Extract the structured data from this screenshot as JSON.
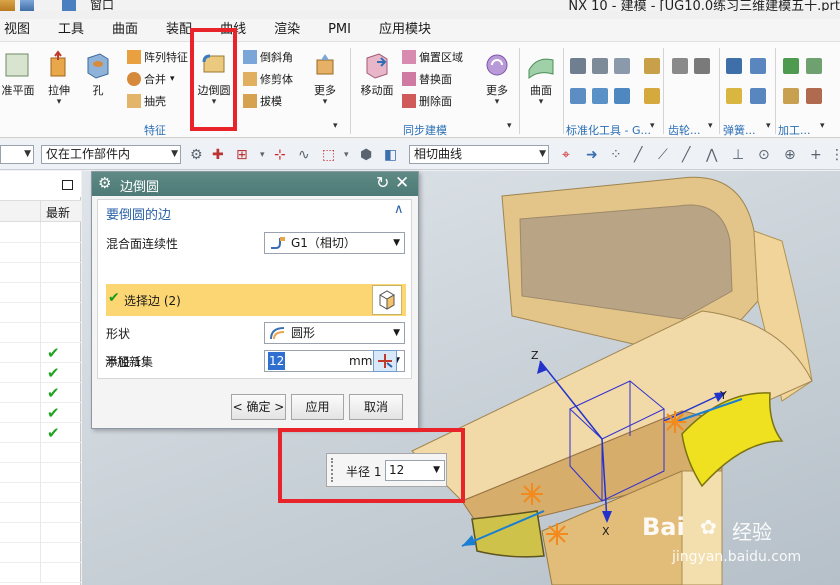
{
  "window": {
    "title": "NX 10 - 建模 - [UG10.0练习三维建模五十.prt",
    "window_menu": "窗口"
  },
  "menubar": [
    "视图",
    "工具",
    "曲面",
    "装配",
    "曲线",
    "渲染",
    "PMI",
    "应用模块"
  ],
  "ribbon": {
    "datum_plane": "准平面",
    "extrude": "拉伸",
    "hole": "孔",
    "pattern_feature": "阵列特征",
    "unite": "合并",
    "shell": "抽壳",
    "edge_blend": "边倒圆",
    "chamfer": "倒斜角",
    "trim_body": "修剪体",
    "draft": "拔模",
    "more_1": "更多",
    "feature_group": "特征",
    "move_face": "移动面",
    "offset_region": "偏置区域",
    "replace_face": "替换面",
    "delete_face": "删除面",
    "more_2": "更多",
    "sync_group": "同步建模",
    "surface": "曲面",
    "std_tools_group": "标准化工具 - G...",
    "gear_group": "齿轮...",
    "spring_group": "弹簧...",
    "machining_group": "加工..."
  },
  "toolbar2": {
    "filter_value": "",
    "scope_value": "仅在工作部件内",
    "curve_rule_value": "相切曲线"
  },
  "navigator": {
    "column_latest": "最新",
    "rows_checked": [
      false,
      false,
      false,
      false,
      false,
      false,
      true,
      true,
      true,
      true,
      true,
      false,
      false,
      false,
      false,
      false,
      false,
      false
    ]
  },
  "dialog": {
    "title": "边倒圆",
    "section": "要倒圆的边",
    "continuity_label": "混合面连续性",
    "continuity_value": "G1（相切）",
    "select_edge_label": "选择边 (2)",
    "shape_label": "形状",
    "shape_value": "圆形",
    "radius_label": "半径 1",
    "radius_value": "12",
    "radius_unit": "mm",
    "add_new_set_label": "添加新集",
    "ok_button": "< 确定 >",
    "apply_button": "应用",
    "cancel_button": "取消"
  },
  "floating_input": {
    "label": "半径 1",
    "value": "12"
  },
  "viewport": {
    "axis_z": "Z",
    "axis_x": "X",
    "axis_y": "Y"
  },
  "watermark": {
    "brand_left": "Bai",
    "brand_right": "经验",
    "url": "jingyan.baidu.com"
  },
  "colors": {
    "dialog_title_bar": "#5f8a86",
    "selection_highlight": "#fbd673",
    "red_highlight": "#e8242a",
    "model_face": "#e9c88f",
    "blend_preview": "#f1e30f",
    "group_label": "#2a6fb6"
  }
}
